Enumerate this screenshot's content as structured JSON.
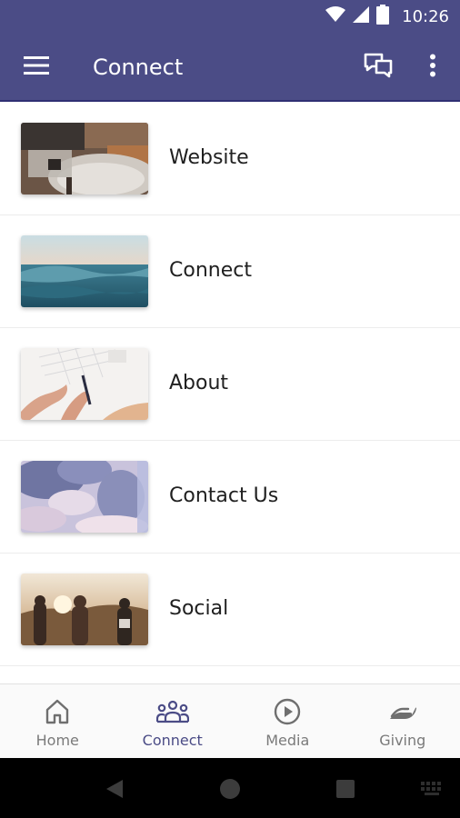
{
  "status_bar": {
    "time": "10:26",
    "icons": [
      "wifi-icon",
      "signal-icon",
      "battery-icon"
    ]
  },
  "app_bar": {
    "title": "Connect",
    "background": "#4b4c86",
    "icons": [
      "menu-icon",
      "chat-icon",
      "more-vert-icon"
    ]
  },
  "list": {
    "items": [
      {
        "label": "Website",
        "image": "living-room-thumbnail"
      },
      {
        "label": "Connect",
        "image": "ocean-waves-thumbnail"
      },
      {
        "label": "About",
        "image": "hands-writing-thumbnail"
      },
      {
        "label": "Contact Us",
        "image": "clouds-sky-thumbnail"
      },
      {
        "label": "Social",
        "image": "friends-sunset-thumbnail"
      }
    ]
  },
  "bottom_nav": {
    "active": "Connect",
    "active_color": "#4b4c86",
    "tabs": [
      {
        "label": "Home",
        "icon": "home-icon"
      },
      {
        "label": "Connect",
        "icon": "people-icon"
      },
      {
        "label": "Media",
        "icon": "play-circle-icon"
      },
      {
        "label": "Giving",
        "icon": "giving-hand-icon"
      }
    ]
  },
  "system_nav": {
    "buttons": [
      "back-icon",
      "home-circle-icon",
      "recents-icon",
      "keyboard-icon"
    ]
  }
}
